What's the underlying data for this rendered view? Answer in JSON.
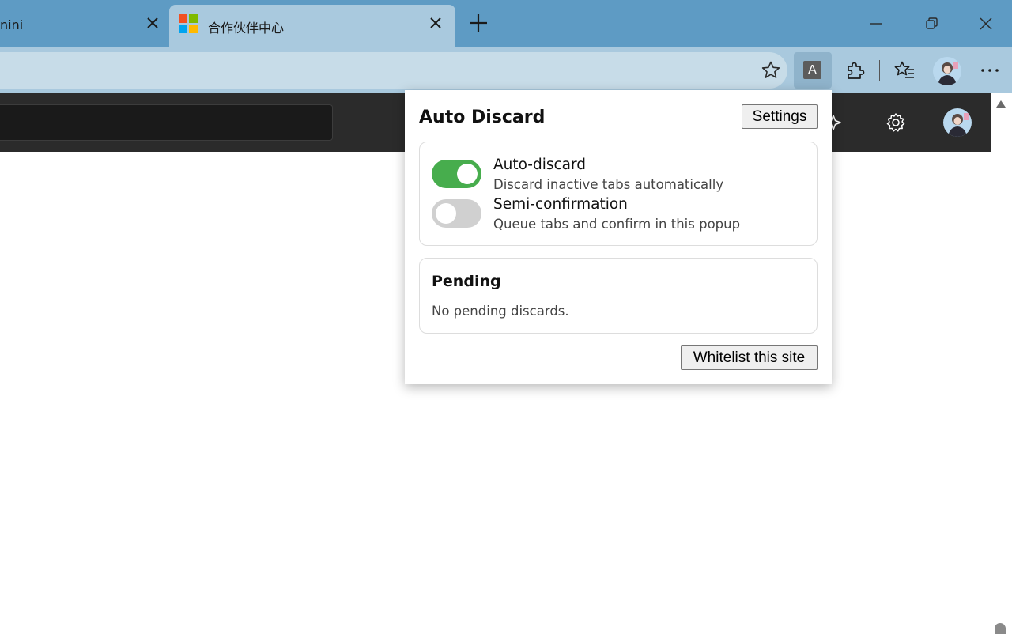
{
  "browser": {
    "tabs": [
      {
        "title": "nini",
        "active": false
      },
      {
        "title": "合作伙伴中心",
        "active": true
      }
    ],
    "new_tab_icon": "plus-icon",
    "window_controls": [
      "minimize-icon",
      "restore-icon",
      "close-icon"
    ],
    "toolbar_icons": [
      "favorite-star-icon",
      "auto-discard-extension-icon",
      "extensions-puzzle-icon",
      "favorites-icon",
      "profile-avatar",
      "more-options-icon"
    ],
    "extension_badge_letter": "A"
  },
  "page": {
    "appbar_icons": [
      "copilot-sparkle-icon",
      "settings-gear-icon",
      "user-avatar"
    ]
  },
  "popup": {
    "title": "Auto Discard",
    "settings_label": "Settings",
    "options": [
      {
        "label": "Auto-discard",
        "description": "Discard inactive tabs automatically",
        "enabled": true
      },
      {
        "label": "Semi-confirmation",
        "description": "Queue tabs and confirm in this popup",
        "enabled": false
      }
    ],
    "pending": {
      "title": "Pending",
      "empty_text": "No pending discards."
    },
    "whitelist_label": "Whitelist this site"
  },
  "colors": {
    "titlebar": "#5e9bc4",
    "toolbar": "#a9c9de",
    "toggle_on": "#47ad4d",
    "toggle_off": "#d0d0d0",
    "appbar": "#2b2b2b"
  }
}
